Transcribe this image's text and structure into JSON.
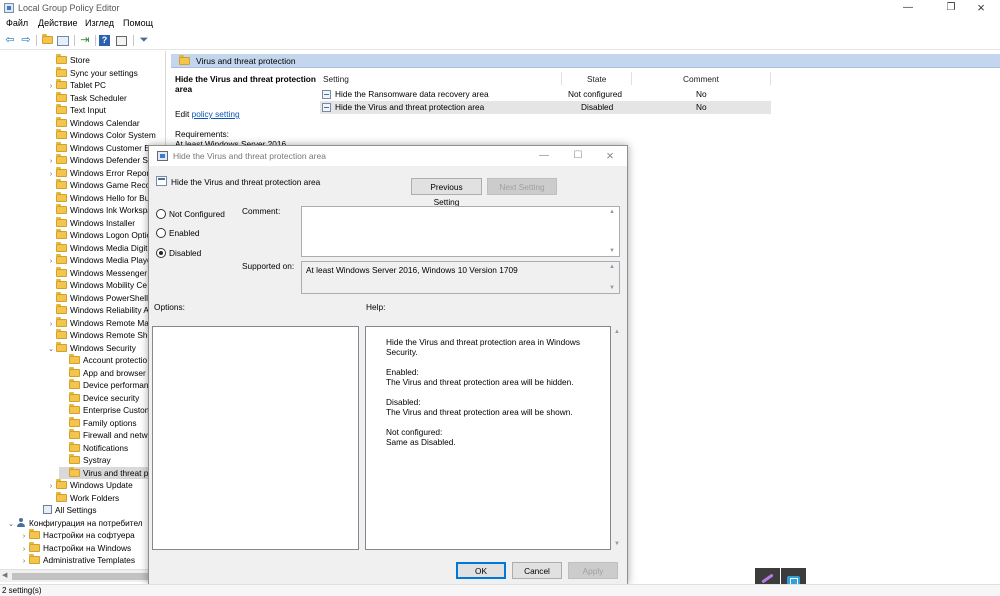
{
  "window": {
    "title": "Local Group Policy Editor"
  },
  "menu": [
    "Файл",
    "Действие",
    "Изглед",
    "Помощ"
  ],
  "tree": {
    "items": [
      {
        "label": "Store"
      },
      {
        "label": "Sync your settings"
      },
      {
        "label": "Tablet PC"
      },
      {
        "label": "Task Scheduler"
      },
      {
        "label": "Text Input"
      },
      {
        "label": "Windows Calendar"
      },
      {
        "label": "Windows Color System"
      },
      {
        "label": "Windows Customer E"
      },
      {
        "label": "Windows Defender Sr"
      },
      {
        "label": "Windows Error Report"
      },
      {
        "label": "Windows Game Reco"
      },
      {
        "label": "Windows Hello for Bu"
      },
      {
        "label": "Windows Ink Workspa"
      },
      {
        "label": "Windows Installer"
      },
      {
        "label": "Windows Logon Optic"
      },
      {
        "label": "Windows Media Digit"
      },
      {
        "label": "Windows Media Playe"
      },
      {
        "label": "Windows Messenger"
      },
      {
        "label": "Windows Mobility Ce"
      },
      {
        "label": "Windows PowerShell"
      },
      {
        "label": "Windows Reliability A"
      },
      {
        "label": "Windows Remote Ma"
      },
      {
        "label": "Windows Remote She"
      },
      {
        "label": "Windows Security"
      },
      {
        "label": "Account protectio"
      },
      {
        "label": "App and browser"
      },
      {
        "label": "Device performan"
      },
      {
        "label": "Device security"
      },
      {
        "label": "Enterprise Custom"
      },
      {
        "label": "Family options"
      },
      {
        "label": "Firewall and netw"
      },
      {
        "label": "Notifications"
      },
      {
        "label": "Systray"
      },
      {
        "label": "Virus and threat p"
      },
      {
        "label": "Windows Update"
      },
      {
        "label": "Work Folders"
      },
      {
        "label": "All Settings"
      },
      {
        "label": "Конфигурация на потребител"
      },
      {
        "label": "Настройки на софтуера"
      },
      {
        "label": "Настройки на Windows"
      },
      {
        "label": "Administrative Templates"
      }
    ]
  },
  "right": {
    "header": "Virus and threat protection",
    "extended": {
      "title": "Hide the Virus and threat protection area",
      "edit_prefix": "Edit",
      "edit_link": "policy setting",
      "requirements_label": "Requirements:",
      "requirements_value": "At least Windows Server 2016"
    },
    "columns": [
      "Setting",
      "State",
      "Comment"
    ],
    "rows": [
      {
        "setting": "Hide the Ransomware data recovery area",
        "state": "Not configured",
        "comment": "No"
      },
      {
        "setting": "Hide the Virus and threat protection area",
        "state": "Disabled",
        "comment": "No"
      }
    ]
  },
  "dialog": {
    "title": "Hide the Virus and threat protection area",
    "setting_name": "Hide the Virus and threat protection area",
    "prev_button": "Previous Setting",
    "next_button": "Next Setting",
    "radios": [
      "Not Configured",
      "Enabled",
      "Disabled"
    ],
    "selected_radio": "Disabled",
    "comment_label": "Comment:",
    "comment_value": "",
    "supported_label": "Supported on:",
    "supported_value": "At least Windows Server 2016, Windows 10 Version 1709",
    "options_label": "Options:",
    "help_label": "Help:",
    "help": [
      "Hide the Virus and threat protection area in Windows Security.",
      "Enabled:\nThe Virus and threat protection area will be hidden.",
      "Disabled:\nThe Virus and threat protection area will be shown.",
      "Not configured:\nSame as Disabled."
    ],
    "ok_button": "OK",
    "cancel_button": "Cancel",
    "apply_button": "Apply"
  },
  "status": {
    "text": "2 setting(s)"
  },
  "icons": [
    "back-arrow-icon",
    "forward-arrow-icon",
    "up-folder-icon",
    "show-hide-tree-icon",
    "export-list-icon",
    "help-icon",
    "properties-icon",
    "filter-icon",
    "minimize-icon",
    "restore-icon",
    "close-icon",
    "folder-icon",
    "user-config-icon",
    "setting-icon",
    "pen-icon",
    "snipping-tool-icon"
  ]
}
